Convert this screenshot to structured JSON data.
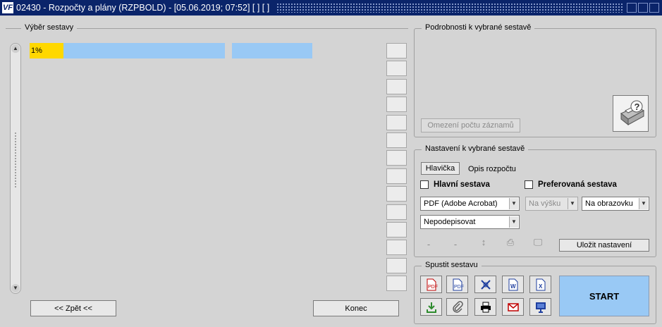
{
  "window": {
    "title": "02430 - Rozpočty a plány (RZPBOLD) - [05.06.2019; 07:52]  [ ]  [ ]",
    "app_icon": "VF"
  },
  "left_panel": {
    "legend": "Výběr sestavy",
    "progress_percent": 0.1,
    "progress_label": "1%",
    "back_button": "<< Zpět <<",
    "end_button": "Konec"
  },
  "details": {
    "legend": "Podrobnosti k vybrané sestavě",
    "limit_button": "Omezení počtu záznamů",
    "help_icon": "printer-question-icon"
  },
  "settings": {
    "legend": "Nastavení k vybrané sestavě",
    "header_button": "Hlavička",
    "header_value": "Opis rozpočtu",
    "main_report_label": "Hlavní sestava",
    "preferred_report_label": "Preferovaná sestava",
    "format_select": "PDF (Adobe Acrobat)",
    "orientation_select": "Na výšku",
    "output_select": "Na obrazovku",
    "signing_select": "Nepodepisovat",
    "dash1": "-",
    "dash2": "-",
    "save_button": "Uložit nastavení"
  },
  "run": {
    "legend": "Spustit sestavu",
    "start_button": "START",
    "colors": {
      "start_bg": "#99c9f5",
      "accent_red": "#c00000",
      "accent_blue": "#1f3f9f",
      "accent_green": "#2e8b2e"
    }
  }
}
